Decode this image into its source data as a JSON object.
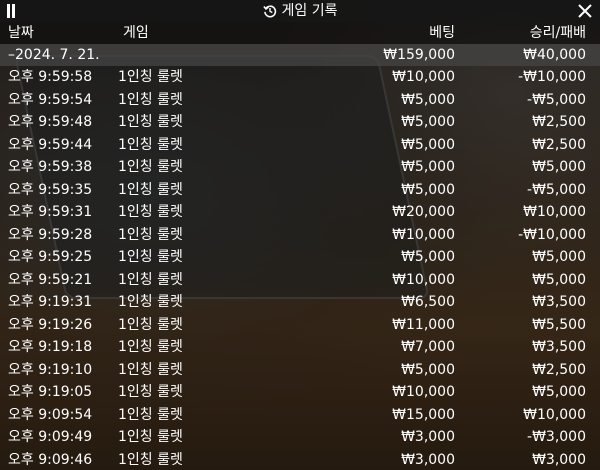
{
  "window": {
    "title": "게임 기록",
    "history_icon": "history-icon",
    "pause_icon": "pause-icon",
    "close_icon": "close-icon"
  },
  "columns": {
    "date": "날짜",
    "game": "게임",
    "bet": "베팅",
    "result": "승리/패배"
  },
  "summary": {
    "date": "–2024. 7. 21.",
    "bet": "₩159,000",
    "result": "₩40,000"
  },
  "rows": [
    {
      "time": "오후 9:59:58",
      "game": "1인칭 룰렛",
      "bet": "₩10,000",
      "result": "-₩10,000"
    },
    {
      "time": "오후 9:59:54",
      "game": "1인칭 룰렛",
      "bet": "₩5,000",
      "result": "-₩5,000"
    },
    {
      "time": "오후 9:59:48",
      "game": "1인칭 룰렛",
      "bet": "₩5,000",
      "result": "₩2,500"
    },
    {
      "time": "오후 9:59:44",
      "game": "1인칭 룰렛",
      "bet": "₩5,000",
      "result": "₩2,500"
    },
    {
      "time": "오후 9:59:38",
      "game": "1인칭 룰렛",
      "bet": "₩5,000",
      "result": "₩5,000"
    },
    {
      "time": "오후 9:59:35",
      "game": "1인칭 룰렛",
      "bet": "₩5,000",
      "result": "-₩5,000"
    },
    {
      "time": "오후 9:59:31",
      "game": "1인칭 룰렛",
      "bet": "₩20,000",
      "result": "₩10,000"
    },
    {
      "time": "오후 9:59:28",
      "game": "1인칭 룰렛",
      "bet": "₩10,000",
      "result": "-₩10,000"
    },
    {
      "time": "오후 9:59:25",
      "game": "1인칭 룰렛",
      "bet": "₩5,000",
      "result": "₩5,000"
    },
    {
      "time": "오후 9:59:21",
      "game": "1인칭 룰렛",
      "bet": "₩10,000",
      "result": "₩5,000"
    },
    {
      "time": "오후 9:19:31",
      "game": "1인칭 룰렛",
      "bet": "₩6,500",
      "result": "₩3,500"
    },
    {
      "time": "오후 9:19:26",
      "game": "1인칭 룰렛",
      "bet": "₩11,000",
      "result": "₩5,500"
    },
    {
      "time": "오후 9:19:18",
      "game": "1인칭 룰렛",
      "bet": "₩7,000",
      "result": "₩3,500"
    },
    {
      "time": "오후 9:19:10",
      "game": "1인칭 룰렛",
      "bet": "₩5,000",
      "result": "₩2,500"
    },
    {
      "time": "오후 9:19:05",
      "game": "1인칭 룰렛",
      "bet": "₩10,000",
      "result": "₩5,000"
    },
    {
      "time": "오후 9:09:54",
      "game": "1인칭 룰렛",
      "bet": "₩15,000",
      "result": "₩10,000"
    },
    {
      "time": "오후 9:09:49",
      "game": "1인칭 룰렛",
      "bet": "₩3,000",
      "result": "-₩3,000"
    },
    {
      "time": "오후 9:09:46",
      "game": "1인칭 룰렛",
      "bet": "₩3,000",
      "result": "₩3,000"
    }
  ],
  "colors": {
    "text": "#ffffff",
    "titlebar": "#141414",
    "summary_bg": "#464646"
  }
}
